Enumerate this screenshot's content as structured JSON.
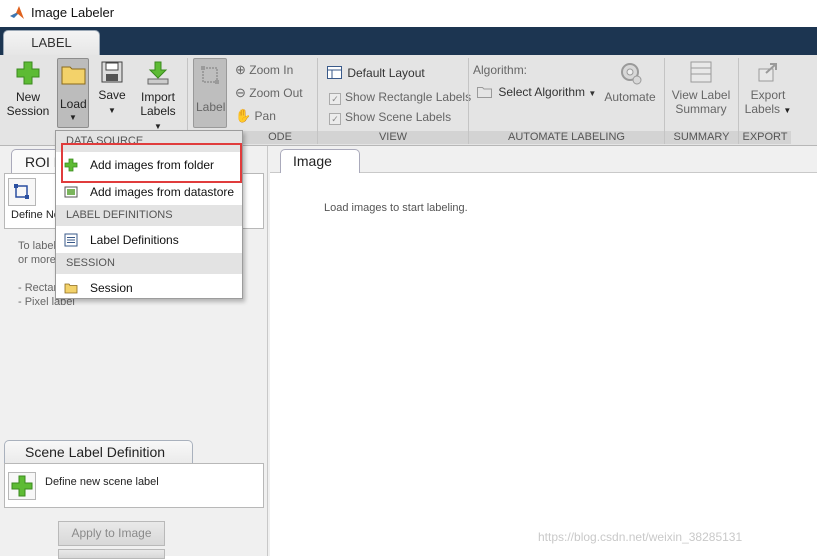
{
  "window": {
    "title": "Image Labeler"
  },
  "tabs": {
    "active": "LABEL"
  },
  "ribbon": {
    "new_session": [
      "New",
      "Session"
    ],
    "load": "Load",
    "save": "Save",
    "import_labels": [
      "Import",
      "Labels"
    ],
    "label": "Label",
    "zoom_in": "Zoom In",
    "zoom_out": "Zoom Out",
    "pan": "Pan",
    "default_layout": "Default Layout",
    "show_rect_labels": "Show Rectangle Labels",
    "show_scene_labels": "Show Scene Labels",
    "algorithm_label": "Algorithm:",
    "select_algorithm": "Select Algorithm",
    "automate": "Automate",
    "view_label_summary": [
      "View Label",
      "Summary"
    ],
    "export_labels": [
      "Export",
      "Labels"
    ],
    "sections": {
      "mode": "ODE",
      "view": "VIEW",
      "automate": "AUTOMATE LABELING",
      "summary": "SUMMARY",
      "export": "EXPORT"
    }
  },
  "menu": {
    "data_source_header": "DATA SOURCE",
    "add_images_folder": "Add images from folder",
    "add_images_datastore": "Add images from datastore",
    "label_definitions_header": "LABEL DEFINITIONS",
    "label_definitions": "Label Definitions",
    "session_header": "SESSION",
    "session": "Session"
  },
  "left_panel": {
    "roi_tab": "ROI Label Definition",
    "define_new_roi": "Define New ROI Label",
    "hint_line1": "To label",
    "hint_line2": "or more",
    "bullet_rect": "- Rectangle",
    "bullet_pixel": "- Pixel label",
    "scene_tab": "Scene Label Definition",
    "define_new_scene": "Define new scene label",
    "apply_to_image": "Apply to Image"
  },
  "right_panel": {
    "image_tab": "Image",
    "empty_message": "Load images to start labeling."
  },
  "watermark": "https://blog.csdn.net/weixin_38285131",
  "colors": {
    "header_blue": "#1c3551",
    "highlight_red": "#e03c3c",
    "plus_green": "#4caf2a"
  }
}
